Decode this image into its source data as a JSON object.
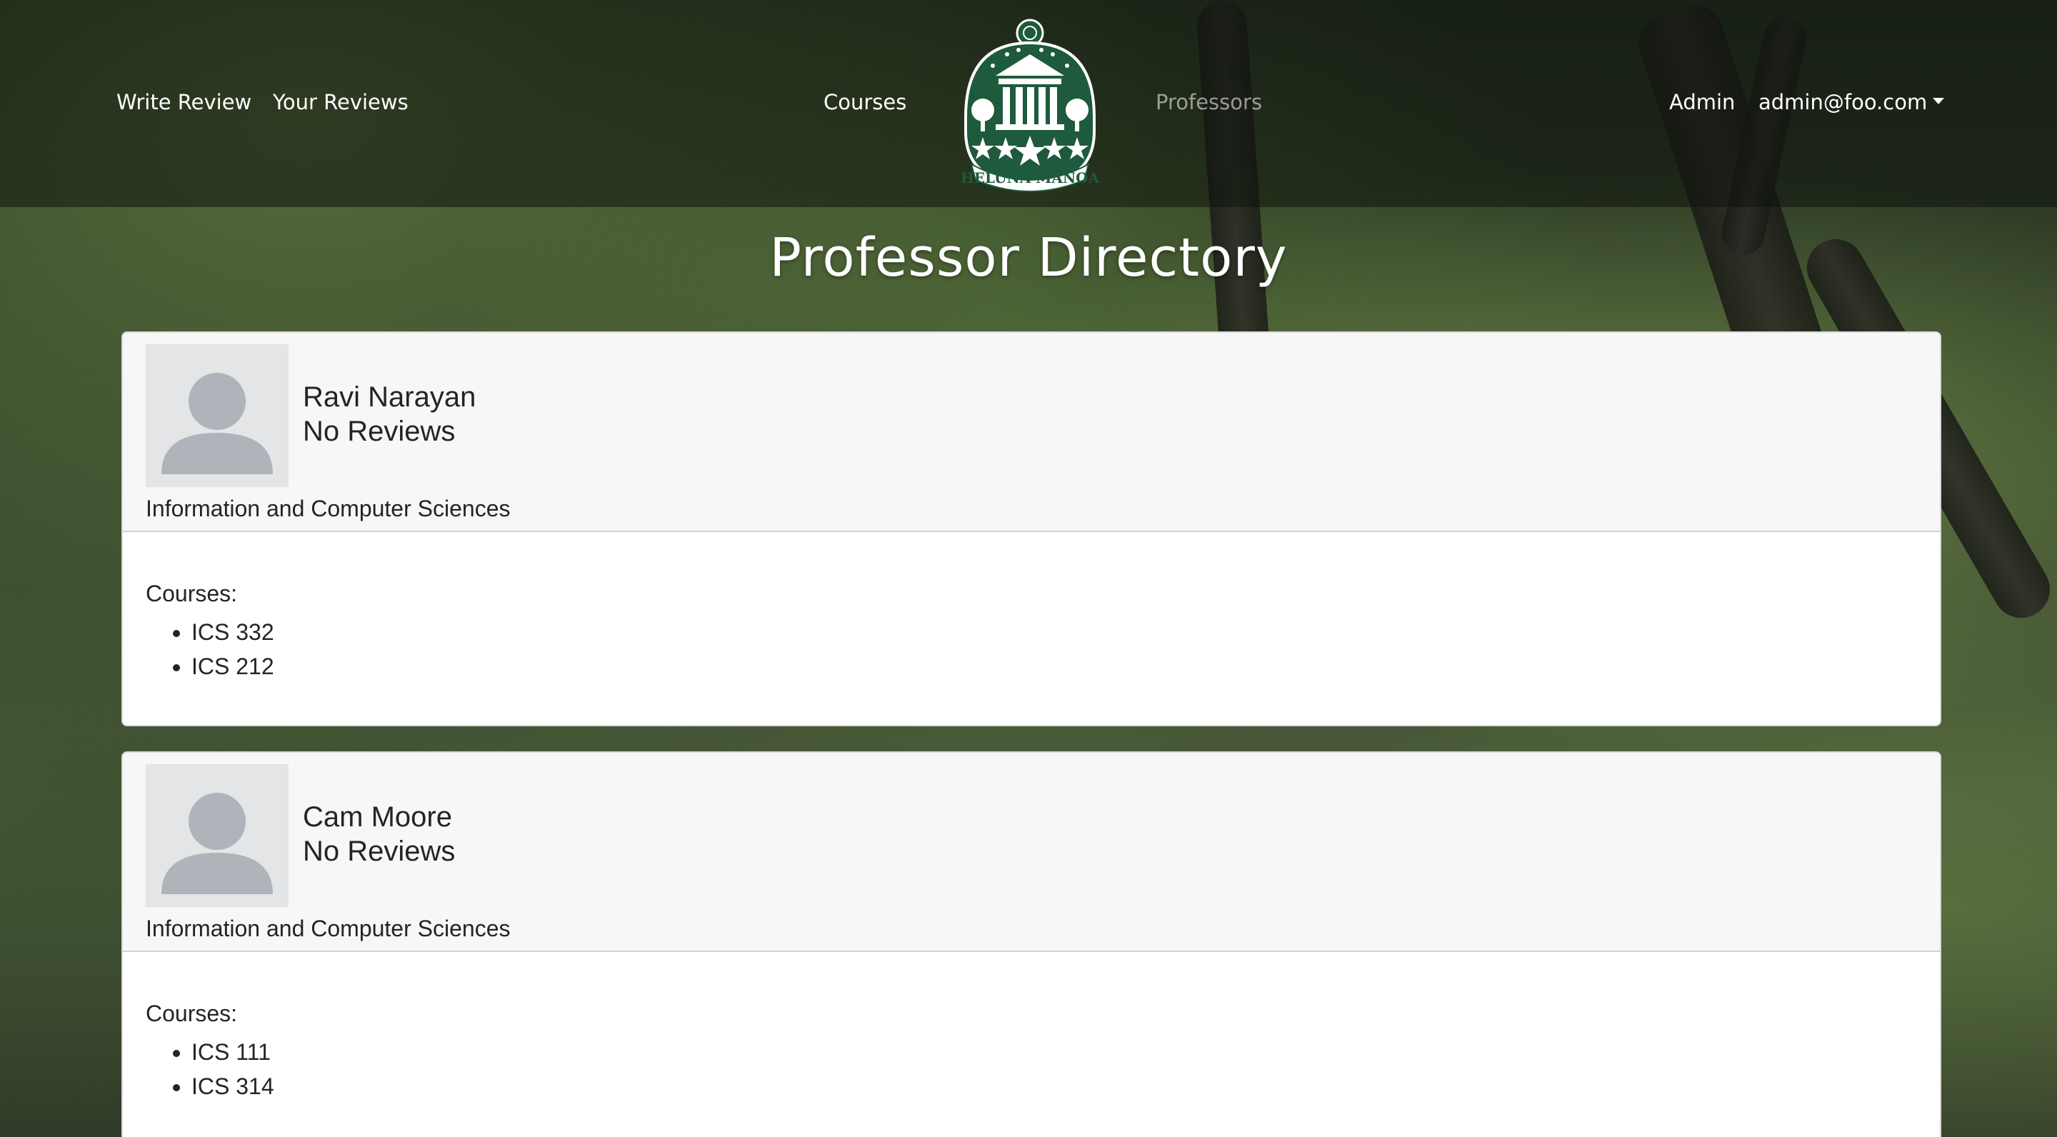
{
  "nav": {
    "left_links": [
      "Write Review",
      "Your Reviews"
    ],
    "center_left_link": "Courses",
    "center_right_link": "Professors",
    "admin_link": "Admin",
    "user_menu": "admin@foo.com",
    "logo_text": "HELUNA MĀNOA"
  },
  "page": {
    "title": "Professor Directory"
  },
  "colors": {
    "logo_green": "#1e5a3c",
    "active_nav": "#ffffff",
    "current_nav": "rgba(255,255,255,0.55)"
  },
  "professors": [
    {
      "name": "Ravi Narayan",
      "reviews": "No Reviews",
      "department": "Information and Computer Sciences",
      "courses_label": "Courses:",
      "courses": [
        "ICS 332",
        "ICS 212"
      ]
    },
    {
      "name": "Cam Moore",
      "reviews": "No Reviews",
      "department": "Information and Computer Sciences",
      "courses_label": "Courses:",
      "courses": [
        "ICS 111",
        "ICS 314"
      ]
    }
  ]
}
